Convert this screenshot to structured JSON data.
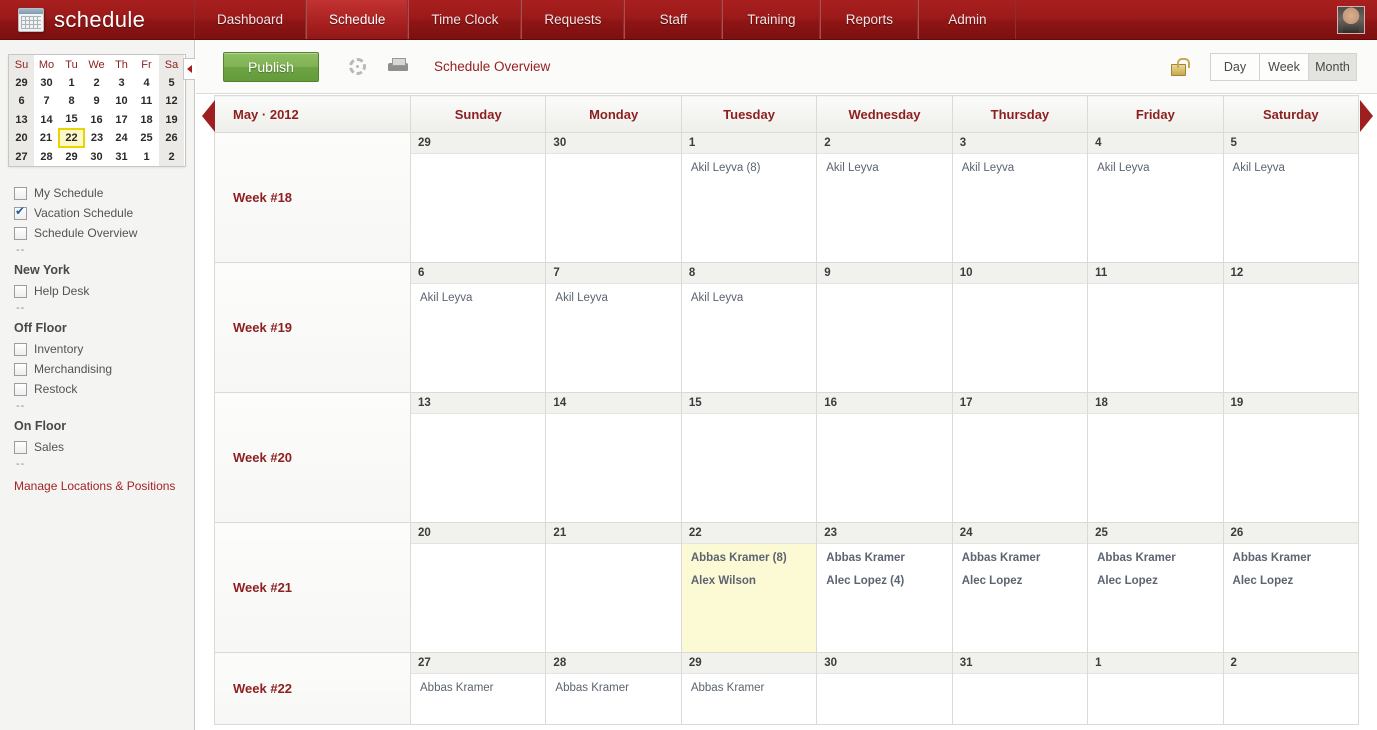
{
  "app": {
    "brand": "schedule",
    "brand_icon": "calendar-icon",
    "avatar_icon": "user-avatar"
  },
  "nav": {
    "items": [
      {
        "label": "Dashboard",
        "active": false
      },
      {
        "label": "Schedule",
        "active": true
      },
      {
        "label": "Time Clock",
        "active": false
      },
      {
        "label": "Requests",
        "active": false
      },
      {
        "label": "Staff",
        "active": false
      },
      {
        "label": "Training",
        "active": false
      },
      {
        "label": "Reports",
        "active": false
      },
      {
        "label": "Admin",
        "active": false
      }
    ]
  },
  "sidebar": {
    "minicalendar": {
      "weekday_headers": [
        "Su",
        "Mo",
        "Tu",
        "We",
        "Th",
        "Fr",
        "Sa"
      ],
      "weeks": [
        [
          "29",
          "30",
          "1",
          "2",
          "3",
          "4",
          "5"
        ],
        [
          "6",
          "7",
          "8",
          "9",
          "10",
          "11",
          "12"
        ],
        [
          "13",
          "14",
          "15",
          "16",
          "17",
          "18",
          "19"
        ],
        [
          "20",
          "21",
          "22",
          "23",
          "24",
          "25",
          "26"
        ],
        [
          "27",
          "28",
          "29",
          "30",
          "31",
          "1",
          "2"
        ]
      ],
      "selected_day": "22"
    },
    "filters": [
      {
        "label": "My Schedule",
        "checked": false
      },
      {
        "label": "Vacation Schedule",
        "checked": true
      },
      {
        "label": "Schedule Overview",
        "checked": false
      }
    ],
    "separator": "--",
    "groups": [
      {
        "name": "New York",
        "items": [
          {
            "label": "Help Desk",
            "checked": false
          }
        ]
      },
      {
        "name": "Off Floor",
        "items": [
          {
            "label": "Inventory",
            "checked": false
          },
          {
            "label": "Merchandising",
            "checked": false
          },
          {
            "label": "Restock",
            "checked": false
          }
        ]
      },
      {
        "name": "On Floor",
        "items": [
          {
            "label": "Sales",
            "checked": false
          }
        ]
      }
    ],
    "manage_link": "Manage Locations & Positions",
    "collapse_icon": "chevron-left-icon"
  },
  "toolbar": {
    "publish_label": "Publish",
    "gear_icon": "gear-icon",
    "print_icon": "printer-icon",
    "title": "Schedule Overview",
    "lock_icon": "unlocked-padlock-icon",
    "views": [
      {
        "label": "Day",
        "active": false
      },
      {
        "label": "Week",
        "active": false
      },
      {
        "label": "Month",
        "active": true
      }
    ]
  },
  "calendar": {
    "prev_icon": "prev-month-arrow",
    "next_icon": "next-month-arrow",
    "period": "May · 2012",
    "day_headers": [
      "Sunday",
      "Monday",
      "Tuesday",
      "Wednesday",
      "Thursday",
      "Friday",
      "Saturday"
    ],
    "today_date": "22",
    "rows": [
      {
        "week_label": "Week #18",
        "days": [
          {
            "date": "29",
            "events": []
          },
          {
            "date": "30",
            "events": []
          },
          {
            "date": "1",
            "events": [
              "Akil Leyva (8)"
            ]
          },
          {
            "date": "2",
            "events": [
              "Akil Leyva"
            ]
          },
          {
            "date": "3",
            "events": [
              "Akil Leyva"
            ]
          },
          {
            "date": "4",
            "events": [
              "Akil Leyva"
            ]
          },
          {
            "date": "5",
            "events": [
              "Akil Leyva"
            ]
          }
        ]
      },
      {
        "week_label": "Week #19",
        "days": [
          {
            "date": "6",
            "events": [
              "Akil Leyva"
            ]
          },
          {
            "date": "7",
            "events": [
              "Akil Leyva"
            ]
          },
          {
            "date": "8",
            "events": [
              "Akil Leyva"
            ]
          },
          {
            "date": "9",
            "events": []
          },
          {
            "date": "10",
            "events": []
          },
          {
            "date": "11",
            "events": []
          },
          {
            "date": "12",
            "events": []
          }
        ]
      },
      {
        "week_label": "Week #20",
        "days": [
          {
            "date": "13",
            "events": []
          },
          {
            "date": "14",
            "events": []
          },
          {
            "date": "15",
            "events": []
          },
          {
            "date": "16",
            "events": []
          },
          {
            "date": "17",
            "events": []
          },
          {
            "date": "18",
            "events": []
          },
          {
            "date": "19",
            "events": []
          }
        ]
      },
      {
        "week_label": "Week #21",
        "days": [
          {
            "date": "20",
            "events": []
          },
          {
            "date": "21",
            "events": []
          },
          {
            "date": "22",
            "events": [
              "Abbas Kramer (8)",
              "Alex Wilson"
            ],
            "today": true,
            "bold": true
          },
          {
            "date": "23",
            "events": [
              "Abbas Kramer",
              "Alec Lopez (4)"
            ],
            "bold": true
          },
          {
            "date": "24",
            "events": [
              "Abbas Kramer",
              "Alec Lopez"
            ],
            "bold": true
          },
          {
            "date": "25",
            "events": [
              "Abbas Kramer",
              "Alec Lopez"
            ],
            "bold": true
          },
          {
            "date": "26",
            "events": [
              "Abbas Kramer",
              "Alec Lopez"
            ],
            "bold": true
          }
        ]
      },
      {
        "week_label": "Week #22",
        "days": [
          {
            "date": "27",
            "events": [
              "Abbas Kramer"
            ]
          },
          {
            "date": "28",
            "events": [
              "Abbas Kramer"
            ]
          },
          {
            "date": "29",
            "events": [
              "Abbas Kramer"
            ]
          },
          {
            "date": "30",
            "events": []
          },
          {
            "date": "31",
            "events": []
          },
          {
            "date": "1",
            "events": []
          },
          {
            "date": "2",
            "events": []
          }
        ]
      }
    ]
  },
  "colors": {
    "brand_red": "#9c1a1a",
    "accent_red": "#8e1f1f",
    "publish_green": "#7fb152",
    "today_yellow": "#fcf9d5"
  }
}
